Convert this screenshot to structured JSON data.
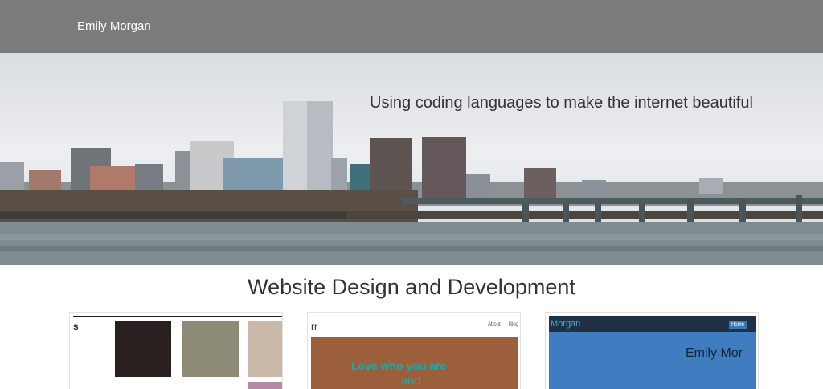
{
  "header": {
    "brand": "Emily Morgan"
  },
  "hero": {
    "tagline": "Using coding languages to make the internet beautiful"
  },
  "section": {
    "title": "Website Design and Development"
  },
  "portfolio": [
    {
      "preview_text": "s"
    },
    {
      "preview_text": "rr",
      "preview_nav": [
        "About",
        "Blog"
      ],
      "preview_banner": [
        "Love who you are",
        "and"
      ]
    },
    {
      "preview_text": "Morgan",
      "preview_button": "Home",
      "preview_name": "Emily Mor"
    }
  ],
  "colors": {
    "header_bg": "#7b7b7b",
    "card3_bar": "#1f3144",
    "card3_accent": "#3a76b8"
  }
}
